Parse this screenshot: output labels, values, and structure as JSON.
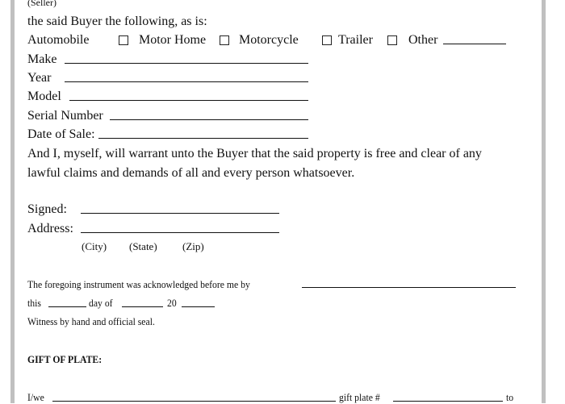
{
  "seller_caption": "(Seller)",
  "intro": "the said Buyer the following, as is:",
  "vehicle_types": {
    "automobile": "Automobile",
    "motor_home": "Motor Home",
    "motorcycle": "Motorcycle",
    "trailer": "Trailer",
    "other": "Other"
  },
  "fields": {
    "make": "Make",
    "year": "Year",
    "model": "Model",
    "serial": "Serial Number",
    "date_of_sale": "Date of Sale:"
  },
  "warranty": {
    "line1": "And I, myself, will warrant unto the Buyer that the said property is free and clear of any",
    "line2": "lawful claims and demands of all and every person whatsoever."
  },
  "signature": {
    "signed": "Signed:",
    "address": "Address:",
    "city": "(City)",
    "state": "(State)",
    "zip": "(Zip)"
  },
  "notary": {
    "acknowledged": "The foregoing instrument was acknowledged before me by",
    "this": "this",
    "day_of": "day of",
    "year_prefix": "20",
    "witness": "Witness by hand and official seal."
  },
  "gift": {
    "heading": "GIFT OF PLATE:",
    "iwe": "I/we",
    "plate": "gift plate #",
    "to": "to"
  }
}
